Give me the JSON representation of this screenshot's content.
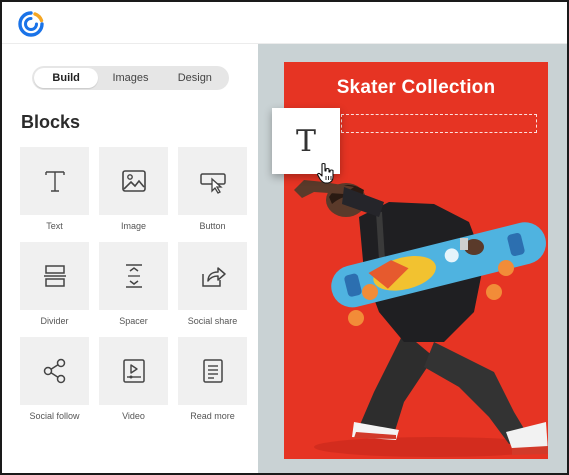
{
  "tabs": [
    {
      "label": "Build",
      "active": true
    },
    {
      "label": "Images",
      "active": false
    },
    {
      "label": "Design",
      "active": false
    }
  ],
  "blocks_title": "Blocks",
  "blocks": [
    {
      "label": "Text",
      "icon": "text-icon"
    },
    {
      "label": "Image",
      "icon": "image-icon"
    },
    {
      "label": "Button",
      "icon": "button-icon"
    },
    {
      "label": "Divider",
      "icon": "divider-icon"
    },
    {
      "label": "Spacer",
      "icon": "spacer-icon"
    },
    {
      "label": "Social share",
      "icon": "social-share-icon"
    },
    {
      "label": "Social follow",
      "icon": "social-follow-icon"
    },
    {
      "label": "Video",
      "icon": "video-icon"
    },
    {
      "label": "Read more",
      "icon": "read-more-icon"
    }
  ],
  "poster": {
    "title": "Skater Collection"
  },
  "drag_block": {
    "glyph": "T"
  },
  "colors": {
    "poster_red": "#e63423",
    "canvas_bg": "#c9d2d4",
    "brand_blue": "#1a73e8",
    "brand_orange": "#f5a623"
  }
}
